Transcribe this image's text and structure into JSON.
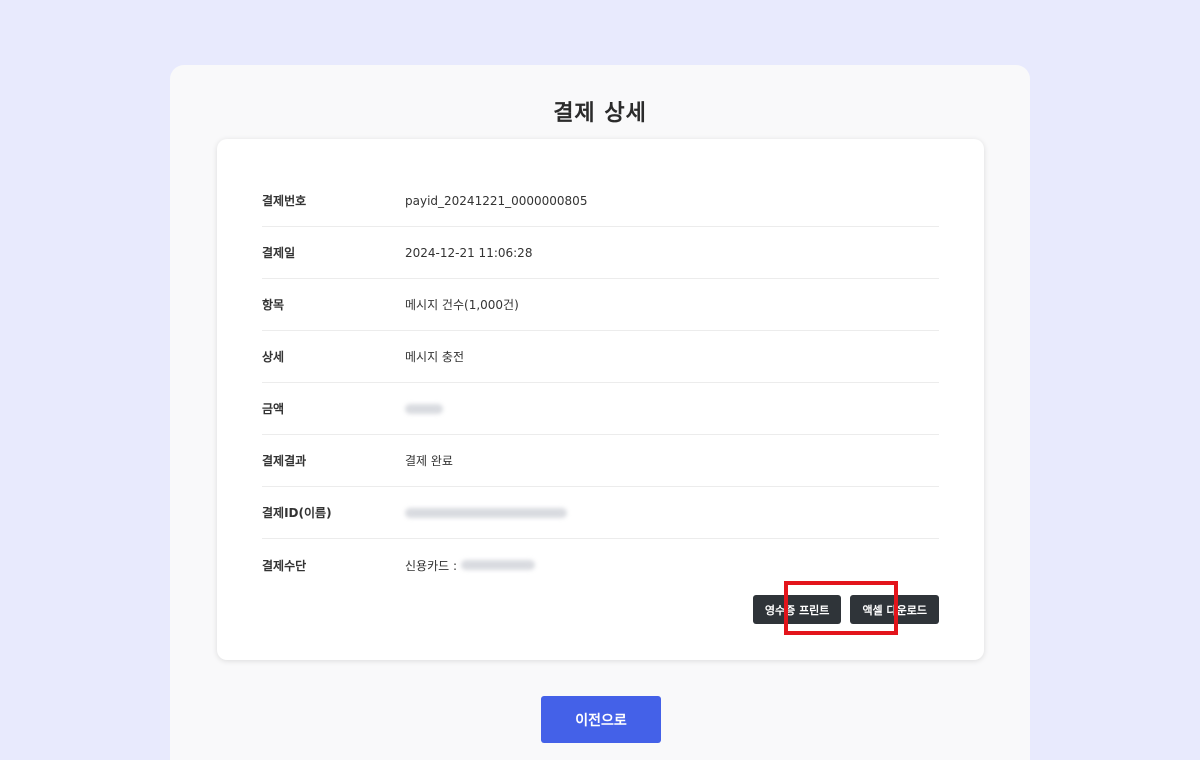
{
  "page": {
    "title": "결제 상세"
  },
  "details": {
    "rows": [
      {
        "label": "결제번호",
        "value": "payid_20241221_0000000805"
      },
      {
        "label": "결제일",
        "value": "2024-12-21 11:06:28"
      },
      {
        "label": "항목",
        "value": "메시지 건수(1,000건)"
      },
      {
        "label": "상세",
        "value": "메시지 충전"
      },
      {
        "label": "금액",
        "value": ""
      },
      {
        "label": "결제결과",
        "value": "결제 완료"
      },
      {
        "label": "결제ID(이름)",
        "value": ""
      },
      {
        "label": "결제수단",
        "value": "신용카드 : "
      }
    ]
  },
  "actions": {
    "print_receipt_label": "영수증 프린트",
    "excel_download_label": "액셀 다운로드",
    "prev_label": "이전으로"
  },
  "colors": {
    "background": "#e8eafd",
    "primary_button": "#4461e8",
    "dark_button": "#2f3439",
    "highlight_border": "#e3141b"
  }
}
